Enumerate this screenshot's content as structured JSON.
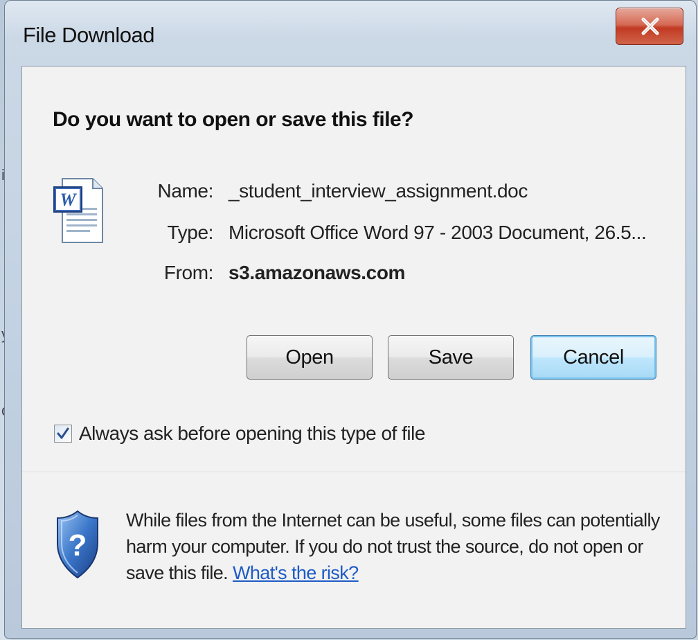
{
  "background": {
    "fragments": [
      "is",
      "y",
      "o"
    ]
  },
  "window": {
    "title": "File Download",
    "close_icon": "close-x-icon"
  },
  "dialog": {
    "heading": "Do you want to open or save this file?",
    "file_icon": "word-document-icon",
    "fields": {
      "name_label": "Name:",
      "name_value": "_student_interview_assignment.doc",
      "type_label": "Type:",
      "type_value": "Microsoft Office Word 97 - 2003 Document, 26.5...",
      "from_label": "From:",
      "from_value": "s3.amazonaws.com"
    },
    "buttons": {
      "open": "Open",
      "save": "Save",
      "cancel": "Cancel"
    },
    "checkbox": {
      "label": "Always ask before opening this type of file",
      "checked": true
    },
    "warning": {
      "icon": "shield-question-icon",
      "text": "While files from the Internet can be useful, some files can potentially harm your computer. If you do not trust the source, do not open or save this file.",
      "link": "What's the risk?"
    }
  },
  "colors": {
    "close_button": "#c13a22",
    "default_button_border": "#3c7fb1",
    "link": "#1e5bc6"
  }
}
